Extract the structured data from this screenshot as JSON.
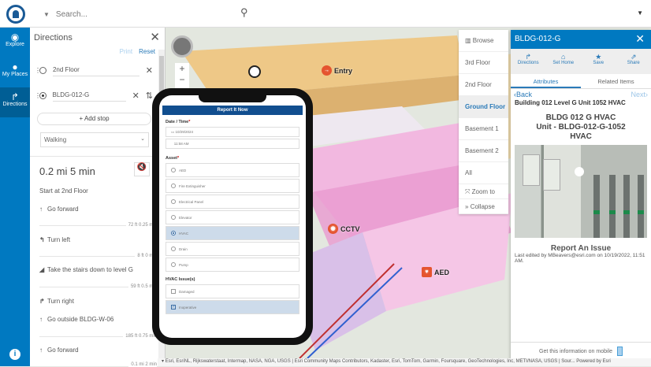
{
  "search": {
    "placeholder": "Search..."
  },
  "nav": [
    {
      "label": "Explore"
    },
    {
      "label": "My Places"
    },
    {
      "label": "Directions"
    }
  ],
  "directions": {
    "title": "Directions",
    "print": "Print",
    "reset": "Reset",
    "stops": [
      "2nd Floor",
      "BLDG-012-G"
    ],
    "add_stop": "Add stop",
    "mode": "Walking",
    "summary": "0.2 mi  5 min",
    "start": "Start at 2nd Floor",
    "steps": [
      {
        "text": "Go forward",
        "dist": "72 ft  0.25 min"
      },
      {
        "text": "Turn left",
        "dist": "8 ft  0 min"
      },
      {
        "text": "Take the stairs down to level G",
        "dist": "59 ft  0.5 min"
      },
      {
        "text": "Turn right",
        "dist": ""
      },
      {
        "text": "Go outside BLDG-W-06",
        "dist": "185 ft  0.75 min"
      },
      {
        "text": "Go forward",
        "dist": "0.1 mi  2 min"
      }
    ]
  },
  "form": {
    "title": "Report It Now",
    "date_label": "Date / Time",
    "date": "10/29/2024",
    "time": "11:58 AM",
    "asset_label": "Asset",
    "assets": [
      "AED",
      "Fire Extinguisher",
      "Electrical Panel",
      "Elevator",
      "HVAC",
      "Drain",
      "Pump"
    ],
    "selected_asset": "HVAC",
    "issues_label": "HVAC Issue(s)",
    "issues": [
      "Damaged",
      "Inoperative"
    ],
    "checked_issue": "Inoperative"
  },
  "map_labels": {
    "entry": "Entry",
    "cctv": "CCTV",
    "aed": "AED"
  },
  "floors": {
    "browse": "Browse",
    "items": [
      "3rd Floor",
      "2nd Floor",
      "Ground Floor",
      "Basement 1",
      "Basement 2",
      "All"
    ],
    "active": "Ground Floor",
    "zoom_to": "Zoom to",
    "collapse": "Collapse"
  },
  "popup": {
    "title": "BLDG-012-G",
    "actions": [
      "Directions",
      "Set Home",
      "Save",
      "Share"
    ],
    "tabs": [
      "Attributes",
      "Related Items"
    ],
    "back": "Back",
    "next": "Next",
    "heading": "Building 012 Level G Unit 1052 HVAC",
    "big": [
      "BLDG 012 G HVAC",
      "Unit - BLDG-012-G-1052",
      "HVAC"
    ],
    "report": "Report An Issue",
    "edited": "Last edited by MBeavers@esri.com on 10/19/2022, 11:51 AM.",
    "mobile": "Get this information on mobile"
  },
  "attribution": "Esri, EsriNL, Rijkswaterstaat, Intermap, NASA, NGA, USGS | Esri Community Maps Contributors, Kadaster, Esri, TomTom, Garmin, Foursquare, GeoTechnologies, Inc, METI/NASA, USGS | Sour...",
  "powered": "Powered by Esri"
}
